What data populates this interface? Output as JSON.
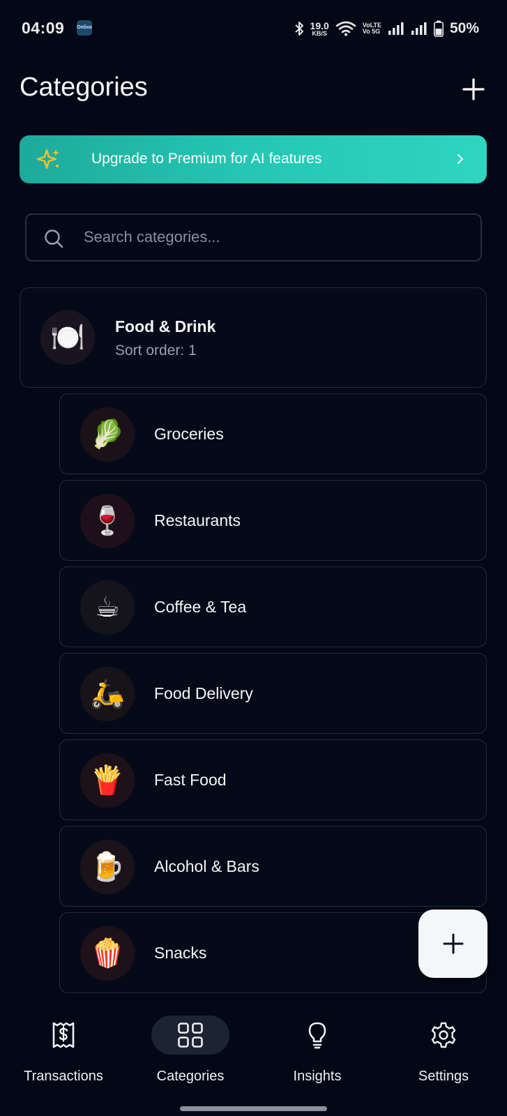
{
  "status_bar": {
    "time": "04:09",
    "app_icon_text": "Onlixo",
    "net_speed_value": "19.0",
    "net_speed_unit": "KB/S",
    "volte_line1": "VoLTE",
    "volte_line2": "Vo 5G",
    "battery_percent": "50%"
  },
  "header": {
    "title": "Categories",
    "add_icon": "plus-icon"
  },
  "premium_banner": {
    "text": "Upgrade to Premium for AI features",
    "icon": "sparkle-icon",
    "accent_start": "#1eaa9a",
    "accent_end": "#2ed5c1",
    "sparkle_color": "#f2c12e"
  },
  "search": {
    "placeholder": "Search categories...",
    "value": ""
  },
  "parent_category": {
    "name": "Food & Drink",
    "sort_order_text": "Sort order: 1",
    "emoji": "🍽️",
    "icon": "plate-cutlery-icon"
  },
  "subcategories": [
    {
      "label": "Groceries",
      "emoji": "🥬",
      "icon": "leafy-greens-icon",
      "avatar_bg": "#1b1219"
    },
    {
      "label": "Restaurants",
      "emoji": "🍷",
      "icon": "wine-glass-icon",
      "avatar_bg": "#1e0f1a"
    },
    {
      "label": "Coffee & Tea",
      "emoji": "☕",
      "icon": "coffee-cup-icon",
      "avatar_bg": "#15141c"
    },
    {
      "label": "Food Delivery",
      "emoji": "🛵",
      "icon": "scooter-icon",
      "avatar_bg": "#181319"
    },
    {
      "label": "Fast Food",
      "emoji": "🍟",
      "icon": "fries-icon",
      "avatar_bg": "#1e1119"
    },
    {
      "label": "Alcohol & Bars",
      "emoji": "🍺",
      "icon": "beer-mug-icon",
      "avatar_bg": "#1a1319"
    },
    {
      "label": "Snacks",
      "emoji": "🍿",
      "icon": "popcorn-icon",
      "avatar_bg": "#1e1119"
    }
  ],
  "fab": {
    "icon": "plus-icon"
  },
  "bottom_nav": [
    {
      "label": "Transactions",
      "icon": "receipt-dollar-icon",
      "active": false
    },
    {
      "label": "Categories",
      "icon": "grid-icon",
      "active": true
    },
    {
      "label": "Insights",
      "icon": "lightbulb-icon",
      "active": false
    },
    {
      "label": "Settings",
      "icon": "gear-icon",
      "active": false
    }
  ]
}
